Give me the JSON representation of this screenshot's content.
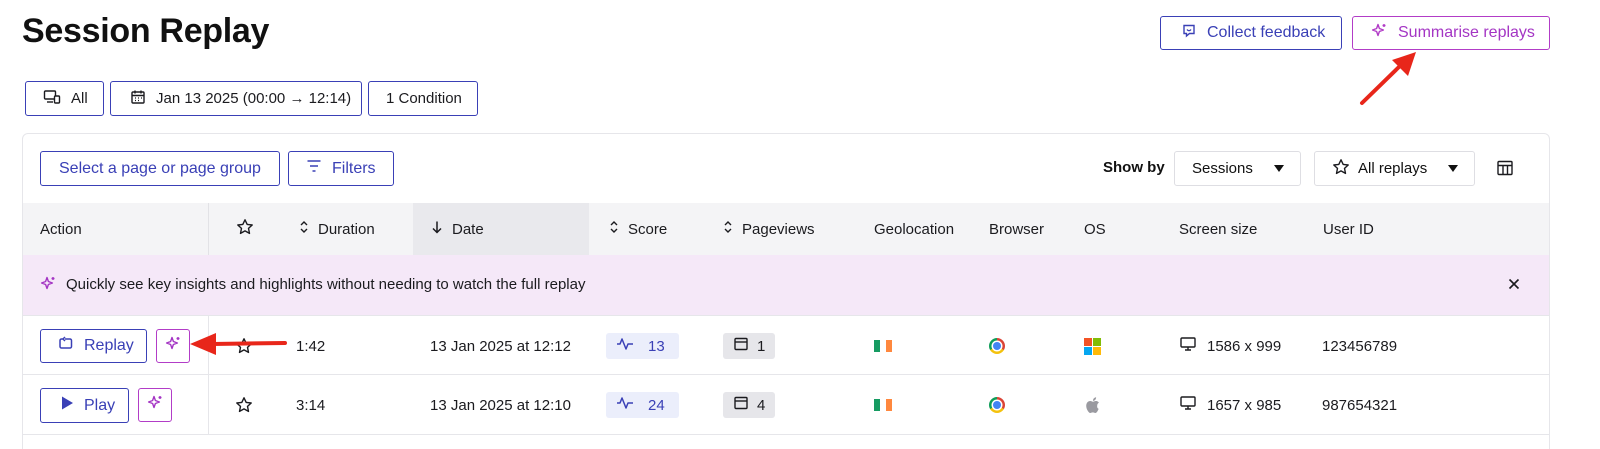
{
  "header": {
    "title": "Session Replay",
    "collect_feedback": "Collect feedback",
    "summarise_replays": "Summarise replays"
  },
  "filters_bar": {
    "device": "All",
    "date_range": "Jan 13 2025 (00:00 → 12:14)",
    "conditions": "1 Condition"
  },
  "toolbar": {
    "page_group": "Select a page or page group",
    "filters": "Filters",
    "show_by_label": "Show by",
    "show_by_value": "Sessions",
    "replays_filter": "All replays"
  },
  "columns": {
    "action": "Action",
    "duration": "Duration",
    "date": "Date",
    "score": "Score",
    "pageviews": "Pageviews",
    "geolocation": "Geolocation",
    "browser": "Browser",
    "os": "OS",
    "screen_size": "Screen size",
    "user_id": "User ID"
  },
  "banner": {
    "text": "Quickly see key insights and highlights without needing to watch the full replay"
  },
  "rows": [
    {
      "action_label": "Replay",
      "duration": "1:42",
      "date": "13 Jan 2025 at 12:12",
      "score": "13",
      "pageviews": "1",
      "geolocation": "ireland-flag-icon",
      "browser": "chrome-icon",
      "os": "windows-icon",
      "screen_size": "1586 x 999",
      "user_id": "123456789"
    },
    {
      "action_label": "Play",
      "duration": "3:14",
      "date": "13 Jan 2025 at 12:10",
      "score": "24",
      "pageviews": "4",
      "geolocation": "ireland-flag-icon",
      "browser": "chrome-icon",
      "os": "apple-icon",
      "screen_size": "1657 x 985",
      "user_id": "987654321"
    }
  ],
  "colors": {
    "primary": "#3a40b6",
    "ai_accent": "#b23cc7",
    "banner_bg": "#f5e8f8",
    "annotation_arrow": "#e8261a"
  }
}
